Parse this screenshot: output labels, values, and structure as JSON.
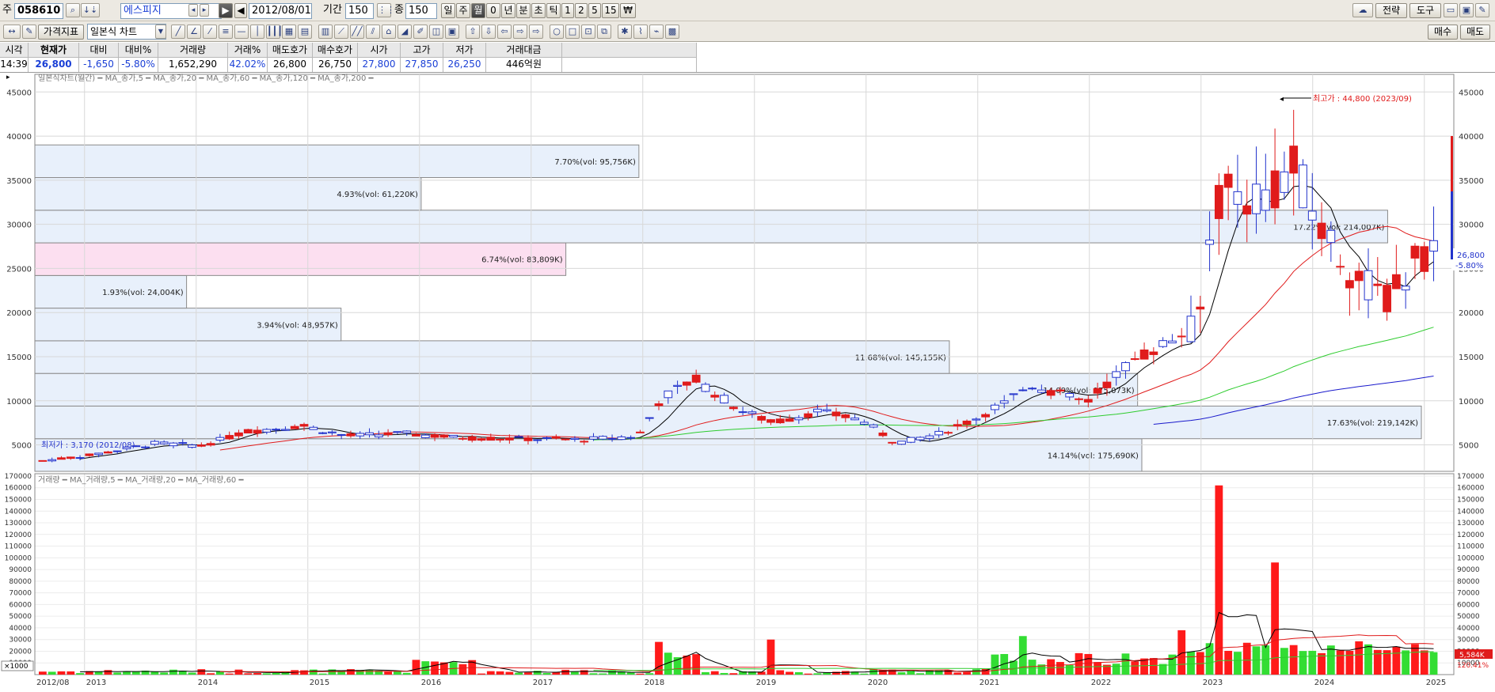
{
  "toolbar": {
    "market_prefix": "주",
    "code": "058610",
    "name": "에스피지",
    "date": "2012/08/01",
    "period_label": "기간",
    "period_value": "150",
    "count_label": "종",
    "count_value": "150",
    "intervals": [
      "일",
      "주",
      "월",
      "0",
      "년",
      "분",
      "초",
      "틱",
      "1",
      "2",
      "5",
      "15",
      "₩"
    ],
    "right_buttons": [
      "전략",
      "도구"
    ],
    "indicator_button": "가격지표",
    "chart_type": "일본식 차트",
    "buy": "매수",
    "sell": "매도"
  },
  "quote": {
    "headers": [
      "시각",
      "현재가",
      "대비",
      "대비%",
      "거래량",
      "거래%",
      "매도호가",
      "매수호가",
      "시가",
      "고가",
      "저가",
      "거래대금"
    ],
    "values": [
      "14:39",
      "26,800",
      "-1,650",
      "-5.80%",
      "1,652,290",
      "42.02%",
      "26,800",
      "26,750",
      "27,800",
      "27,850",
      "26,250",
      "446억원"
    ]
  },
  "chart_data": {
    "type": "candlestick",
    "price_legend": "일본식차트(월간) ━ MA_종가,5 ━ MA_종가,20 ━ MA_종가,60 ━ MA_종가,120 ━ MA_종가,200 ━",
    "volume_legend": "거래량 ━ MA_거래량,5 ━ MA_거래량,20 ━ MA_거래량,60 ━",
    "x_labels": [
      "2012/08",
      "2013",
      "2014",
      "2015",
      "2016",
      "2017",
      "2018",
      "2019",
      "2020",
      "2021",
      "2022",
      "2023",
      "2024",
      "2025"
    ],
    "price_ticks": [
      5000,
      10000,
      15000,
      20000,
      25000,
      30000,
      35000,
      40000,
      45000
    ],
    "price_ylim": [
      2000,
      47000
    ],
    "volume_ticks": [
      10000,
      20000,
      30000,
      40000,
      50000,
      60000,
      70000,
      80000,
      90000,
      100000,
      110000,
      120000,
      130000,
      140000,
      150000,
      160000,
      170000
    ],
    "volume_ylim": [
      0,
      172000
    ],
    "volume_unit_label": "×1000",
    "last_price_label": "26,800",
    "last_change_label": "-5.80%",
    "volume_last_label": "5,584K",
    "volume_pct_label": "120.41%",
    "high_annotation": "최고가 : 44,800 (2023/09)",
    "low_annotation": "최저가 : 3,170 (2012/08)",
    "volume_profile": [
      {
        "low": 2000,
        "high": 5700,
        "label": "14.14%(vol: 175,690K)",
        "extent": 0.788,
        "highlight": false
      },
      {
        "low": 5700,
        "high": 9400,
        "label": "17.63%(vol: 219,142K)",
        "extent": 0.987,
        "highlight": false
      },
      {
        "low": 9400,
        "high": 13100,
        "label": "14.09%(vol: 175,073K)",
        "extent": 0.785,
        "highlight": false
      },
      {
        "low": 13100,
        "high": 16800,
        "label": "11.68%(vol: 145,155K)",
        "extent": 0.651,
        "highlight": false
      },
      {
        "low": 16800,
        "high": 20500,
        "label": "3.94%(vol: 48,957K)",
        "extent": 0.218,
        "highlight": false
      },
      {
        "low": 20500,
        "high": 24200,
        "label": "1.93%(vol: 24,004K)",
        "extent": 0.108,
        "highlight": false
      },
      {
        "low": 24200,
        "high": 27900,
        "label": "6.74%(vol: 83,809K)",
        "extent": 0.378,
        "highlight": true
      },
      {
        "low": 27900,
        "high": 31600,
        "label": "17.22%(vol: 214,007K)",
        "extent": 0.963,
        "highlight": false
      },
      {
        "low": 31600,
        "high": 35300,
        "label": "4.93%(vol: 61,220K)",
        "extent": 0.275,
        "highlight": false
      },
      {
        "low": 35300,
        "high": 39000,
        "label": "7.70%(vol: 95,756K)",
        "extent": 0.43,
        "highlight": false
      }
    ]
  }
}
